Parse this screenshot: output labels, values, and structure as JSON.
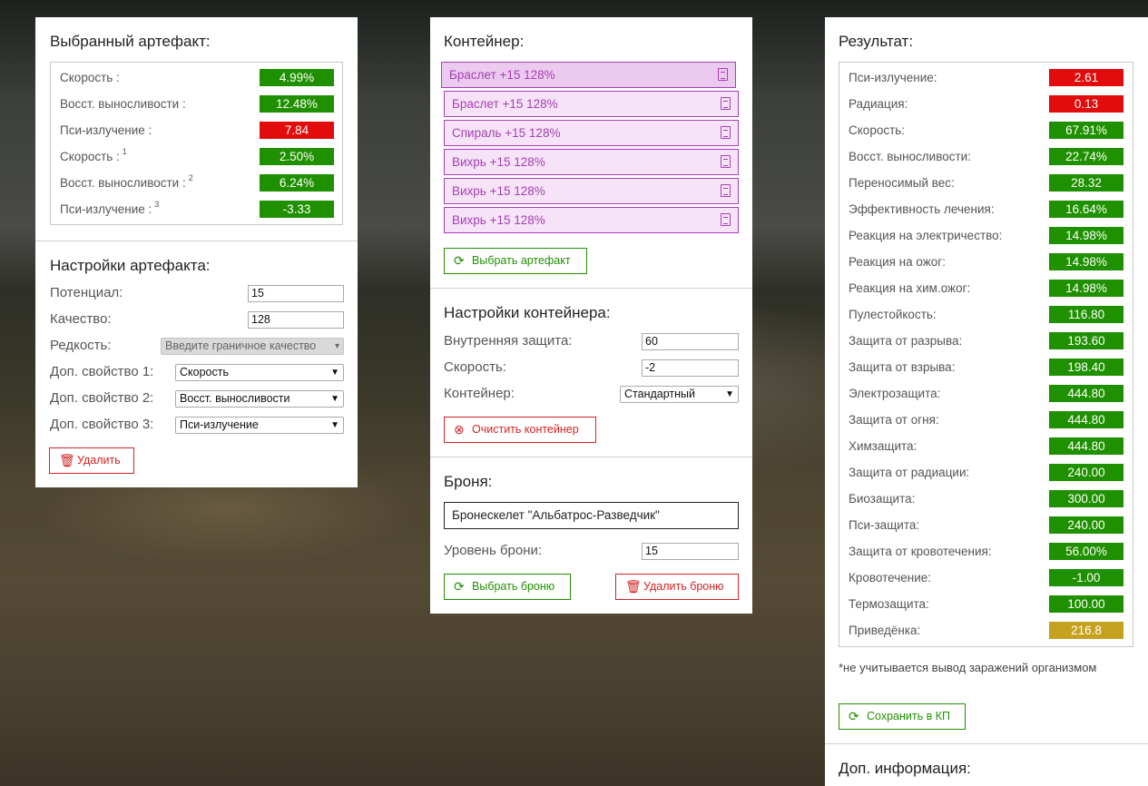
{
  "artifact_panel": {
    "title": "Выбранный артефакт:",
    "stats": [
      {
        "label": "Скорость :",
        "sup": "",
        "value": "4.99%",
        "color": "green"
      },
      {
        "label": "Восст. выносливости :",
        "sup": "",
        "value": "12.48%",
        "color": "green"
      },
      {
        "label": "Пси-излучение :",
        "sup": "",
        "value": "7.84",
        "color": "red"
      },
      {
        "label": "Скорость :",
        "sup": "1",
        "value": "2.50%",
        "color": "green"
      },
      {
        "label": "Восст. выносливости :",
        "sup": "2",
        "value": "6.24%",
        "color": "green"
      },
      {
        "label": "Пси-излучение :",
        "sup": "3",
        "value": "-3.33",
        "color": "green"
      }
    ],
    "settings_title": "Настройки артефакта:",
    "potential_label": "Потенциал:",
    "potential_value": "15",
    "quality_label": "Качество:",
    "quality_value": "128",
    "rarity_label": "Редкость:",
    "rarity_value": "Введите граничное качество",
    "extra1_label": "Доп. свойство 1:",
    "extra1_value": "Скорость",
    "extra2_label": "Доп. свойство 2:",
    "extra2_value": "Восст. выносливости",
    "extra3_label": "Доп. свойство 3:",
    "extra3_value": "Пси-излучение",
    "delete_label": "Удалить"
  },
  "container_panel": {
    "title": "Контейнер:",
    "items": [
      "Браслет +15 128%",
      "Браслет +15 128%",
      "Спираль +15 128%",
      "Вихрь +15 128%",
      "Вихрь +15 128%",
      "Вихрь +15 128%"
    ],
    "choose_artifact_label": "Выбрать артефакт",
    "settings_title": "Настройки контейнера:",
    "inner_protection_label": "Внутренняя защита:",
    "inner_protection_value": "60",
    "speed_label": "Скорость:",
    "speed_value": "-2",
    "container_label": "Контейнер:",
    "container_value": "Стандартный",
    "clear_label": "Очистить контейнер",
    "armor_title": "Броня:",
    "armor_name": "Бронескелет \"Альбатрос-Разведчик\"",
    "armor_level_label": "Уровень брони:",
    "armor_level_value": "15",
    "choose_armor_label": "Выбрать броню",
    "delete_armor_label": "Удалить броню"
  },
  "result_panel": {
    "title": "Результат:",
    "stats": [
      {
        "label": "Пси-излучение:",
        "value": "2.61",
        "color": "red"
      },
      {
        "label": "Радиация:",
        "value": "0.13",
        "color": "red"
      },
      {
        "label": "Скорость:",
        "value": "67.91%",
        "color": "green"
      },
      {
        "label": "Восст. выносливости:",
        "value": "22.74%",
        "color": "green"
      },
      {
        "label": "Переносимый вес:",
        "value": "28.32",
        "color": "green"
      },
      {
        "label": "Эффективность лечения:",
        "value": "16.64%",
        "color": "green"
      },
      {
        "label": "Реакция на электричество:",
        "value": "14.98%",
        "color": "green"
      },
      {
        "label": "Реакция на ожог:",
        "value": "14.98%",
        "color": "green"
      },
      {
        "label": "Реакция на хим.ожог:",
        "value": "14.98%",
        "color": "green"
      },
      {
        "label": "Пулестойкость:",
        "value": "116.80",
        "color": "green"
      },
      {
        "label": "Защита от разрыва:",
        "value": "193.60",
        "color": "green"
      },
      {
        "label": "Защита от взрыва:",
        "value": "198.40",
        "color": "green"
      },
      {
        "label": "Электрозащита:",
        "value": "444.80",
        "color": "green"
      },
      {
        "label": "Защита от огня:",
        "value": "444.80",
        "color": "green"
      },
      {
        "label": "Химзащита:",
        "value": "444.80",
        "color": "green"
      },
      {
        "label": "Защита от радиации:",
        "value": "240.00",
        "color": "green"
      },
      {
        "label": "Биозащита:",
        "value": "300.00",
        "color": "green"
      },
      {
        "label": "Пси-защита:",
        "value": "240.00",
        "color": "green"
      },
      {
        "label": "Защита от кровотечения:",
        "value": "56.00%",
        "color": "green"
      },
      {
        "label": "Кровотечение:",
        "value": "-1.00",
        "color": "green"
      },
      {
        "label": "Термозащита:",
        "value": "100.00",
        "color": "green"
      },
      {
        "label": "Приведёнка:",
        "value": "216.8",
        "color": "gold"
      }
    ],
    "note": "*не учитывается вывод заражений организмом",
    "save_label": "Сохранить в КП",
    "extra_title": "Доп. информация:"
  },
  "colors": {
    "green": "#1f9100",
    "red": "#e30c0c",
    "gold": "#c6a11e",
    "item": "#a540b3"
  }
}
